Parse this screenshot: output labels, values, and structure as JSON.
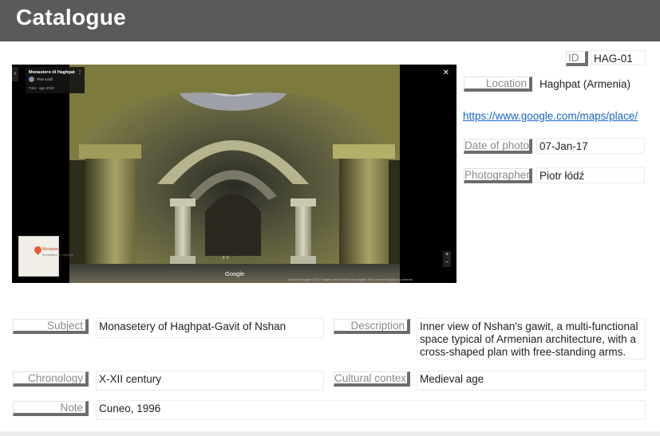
{
  "header": {
    "title": "Catalogue"
  },
  "record": {
    "id_label": "ID",
    "id_value": "HAG-01",
    "location_label": "Location",
    "location_value": "Haghpat (Armenia)",
    "link": "https://www.google.com/maps/place/",
    "date_label": "Date of photo",
    "date_value": "07-Jan-17",
    "photographer_label": "Photographer",
    "photographer_value": "Piotr łódź",
    "subject_label": "Subject",
    "subject_value": "Monasetery of Haghpat-Gavit of Nshan",
    "description_label": "Description",
    "description_value": "Inner view of Nshan's gawit, a multi-functional space typical of Armenian architecture, with a cross-shaped plan with free-standing arms. The",
    "chronology_label": "Chronology",
    "chronology_value": "X-XII century",
    "cultural_label": "Cultural contex",
    "cultural_value": "Medieval age",
    "note_label": "Note",
    "note_value": "Cuneo, 1996"
  },
  "viewer": {
    "place_title": "Monastero di Haghpat",
    "user": "Piotr Łódź",
    "photo_date": "Foto - ago 2019",
    "map_label": "Monaster",
    "map_sublabel": "Monastero di Haghpat",
    "google_label": "Google",
    "footer_text": "Dati dell'immagine ©2017   Images may be subject to copyright.   Italia   Termini   Segnala un problema",
    "collapse_glyph": "‹",
    "close_glyph": "✕",
    "menu_glyph": "⋮",
    "nav_glyph": "‹  ›",
    "zoom_in_glyph": "+",
    "zoom_out_glyph": "−"
  },
  "icons": {
    "close": "close-icon",
    "collapse": "chevron-left-icon",
    "menu": "more-vert-icon",
    "map_pin": "map-pin-icon"
  }
}
